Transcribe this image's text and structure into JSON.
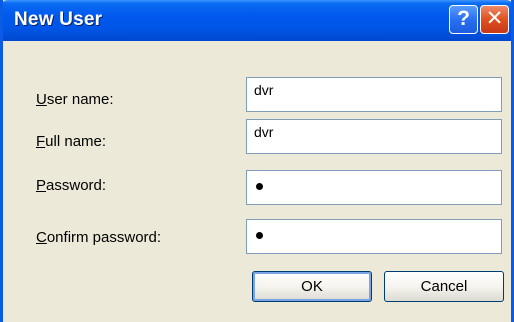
{
  "window": {
    "title": "New User",
    "help_glyph": "?",
    "close_glyph": "✕"
  },
  "form": {
    "username": {
      "label_mnemonic": "U",
      "label_rest": "ser name:",
      "value": "dvr"
    },
    "fullname": {
      "label_mnemonic": "F",
      "label_rest": "ull name:",
      "value": "dvr"
    },
    "password": {
      "label_mnemonic": "P",
      "label_rest": "assword:",
      "masked_length": 1
    },
    "confirm": {
      "label_mnemonic": "C",
      "label_rest": "onfirm password:",
      "masked_length": 1
    }
  },
  "buttons": {
    "ok_label": "OK",
    "cancel_label": "Cancel"
  },
  "colors": {
    "titlebar": "#0055e5",
    "dialog_bg": "#ece9d8",
    "close": "#e0501e"
  },
  "icons": [
    "help-icon",
    "close-icon"
  ]
}
